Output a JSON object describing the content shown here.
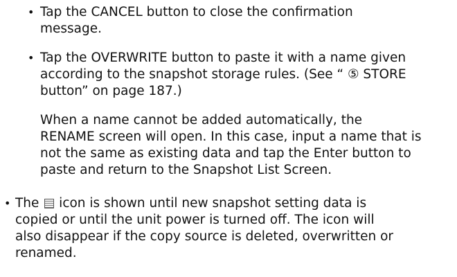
{
  "sub_items": [
    {
      "lines": [
        "Tap the CANCEL button to close the confirmation",
        "message."
      ]
    },
    {
      "lines": [
        "Tap the OVERWRITE button to paste it with a name given",
        "according to the snapshot storage rules. (See “ ⑤  STORE",
        "button” on page 187.)"
      ]
    }
  ],
  "note_paragraph": {
    "lines": [
      "When a name cannot be added automatically, the",
      "RENAME screen will open. In this case, input a name that is",
      "not the same as existing data and tap the Enter button to",
      "paste and return to the Snapshot List Screen."
    ]
  },
  "main_bullet": {
    "line1_before": "The ",
    "icon_name": "list-icon",
    "line1_after": " icon is shown until new snapshot setting data is",
    "lines": [
      "copied or until the unit power is turned off. The icon will",
      "also disappear if the copy source is deleted, overwritten or",
      "renamed."
    ]
  },
  "bullet_symbol": "•"
}
